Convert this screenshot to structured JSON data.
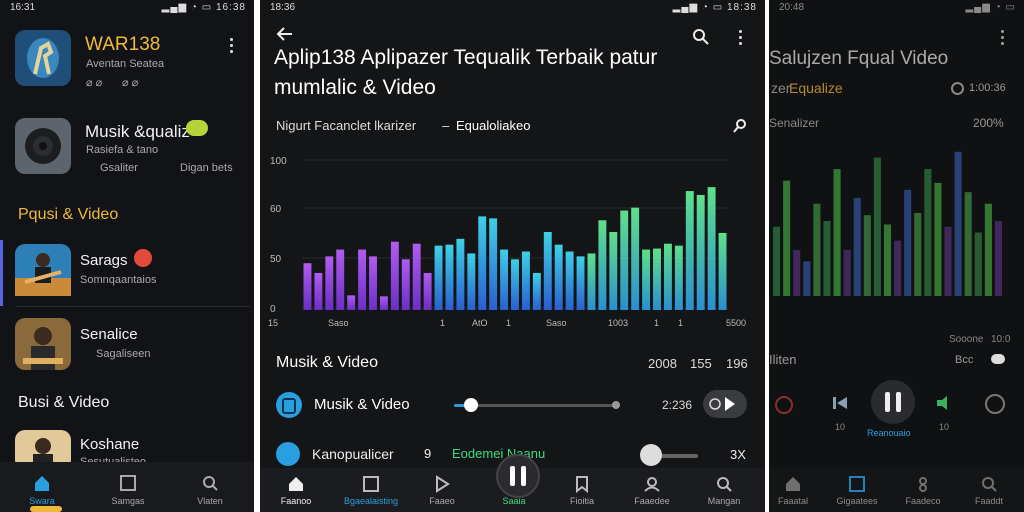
{
  "left": {
    "status_time": "16:31",
    "status_right": "16:38",
    "apps": [
      {
        "name": "WAR138",
        "sub": "Aventan Seatea",
        "meta": [
          "⌀ ⌀",
          "⌀ ⌀"
        ]
      },
      {
        "name": "Musik &qualiz",
        "sub": "Rasiefa & tano",
        "meta_a": "Gsaliter",
        "meta_b": "Digan bets"
      }
    ],
    "section1": "Pqusi & Video",
    "items": [
      {
        "title": "Sarags",
        "sub": "Somnqaantaios"
      },
      {
        "title": "Senalice",
        "sub": "Sagaliseen"
      }
    ],
    "section2": "Busi & Video",
    "item3_title": "Koshane",
    "item3_sub": "Sesutualisteo",
    "nav": [
      "Swara",
      "Samgas",
      "Vlaten"
    ]
  },
  "middle": {
    "status_time": "18:36",
    "status_right": "18:38",
    "title_line1": "Aplip138 Aplipazer Tequalik Terbaik patur",
    "title_line2": "mumlalic & Video",
    "subheader_a": "Nigurt Facanclet lkarizer",
    "subheader_b": "Equaloliakeo",
    "y_ticks": [
      "100",
      "60",
      "50",
      "0"
    ],
    "x_ticks": [
      "15",
      "Saso",
      "1",
      "AtO",
      "1",
      "Saso",
      "1003",
      "1",
      "1",
      "5500"
    ],
    "section_title": "Musik & Video",
    "stats": [
      "2008",
      "155",
      "196"
    ],
    "track_label": "Musik & Video",
    "track_time": "2:236",
    "row2_label": "Kanopualicer",
    "row2_mid": "Eodemei Naanu",
    "row2_x": "3X",
    "row2_num": "9",
    "nav": [
      "Faanoo",
      "Bgaealaisting",
      "Faaeo",
      "Saaia",
      "Fioitia",
      "Faaedee",
      "Mangan"
    ]
  },
  "right": {
    "status_time": "20:48",
    "title": "Salujzen Fqual Video",
    "sub_a": "zer",
    "sub_b": "Equalize",
    "duration": "1:00:36",
    "eq_label": "Senalizer",
    "percent": "200%",
    "labels_a": [
      "Sooone",
      "10:0"
    ],
    "section": "Iliten",
    "label_b": "Bcc",
    "player_a": "10",
    "player_b": "10",
    "player_label": "Reanouaio",
    "nav": [
      "Faaatal",
      "Gigaatees",
      "Faadeco",
      "Faaddt"
    ]
  },
  "colors": {
    "accent": "#f0b93a",
    "blue": "#2a9fe0",
    "green": "#3ddc84",
    "purple": "#9b4ddf"
  },
  "chart_data": [
    {
      "type": "bar",
      "title": "",
      "xlabel": "",
      "ylabel": "",
      "ylim": [
        0,
        160
      ],
      "y_ticks": [
        100,
        60,
        50,
        0
      ],
      "values": [
        48,
        38,
        55,
        62,
        15,
        62,
        55,
        14,
        70,
        52,
        68,
        38,
        66,
        67,
        73,
        58,
        96,
        94,
        62,
        52,
        60,
        38,
        80,
        67,
        60,
        55,
        58,
        92,
        80,
        102,
        105,
        62,
        63,
        68,
        66,
        122,
        118,
        126,
        79
      ]
    },
    {
      "type": "bar",
      "title": "",
      "values": [
        60,
        100,
        40,
        30,
        80,
        65,
        110,
        40,
        85,
        70,
        120,
        62,
        48,
        92,
        72,
        110,
        98,
        60,
        125,
        90,
        55,
        80,
        65
      ]
    }
  ]
}
